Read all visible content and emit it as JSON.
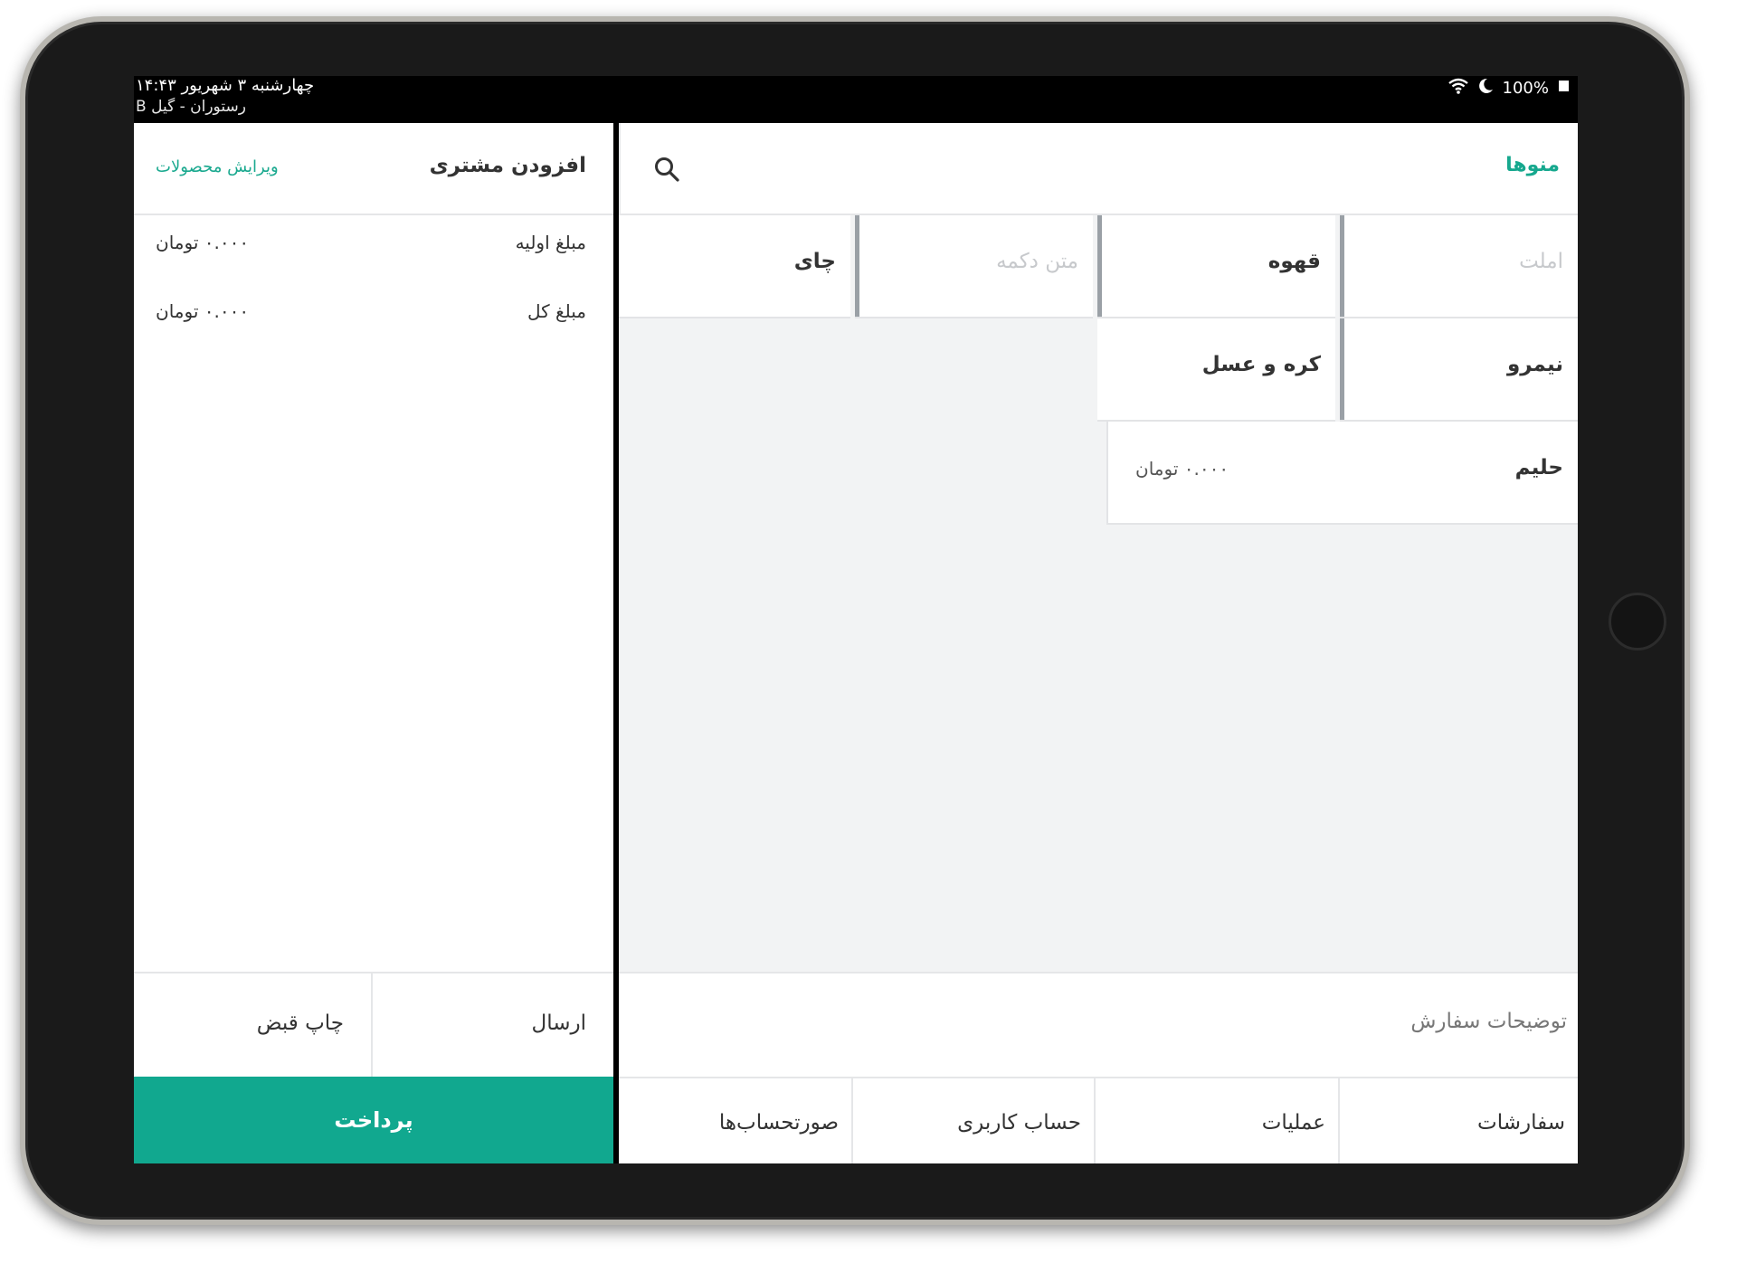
{
  "status_bar": {
    "datetime": "چهارشنبه ۳ شهریور  ۱۴:۴۳",
    "store_name": "رستوران - گیل B",
    "battery": "100%",
    "wifi_icon": "wifi-icon",
    "moon_icon": "moon-icon",
    "battery_icon": "battery-icon"
  },
  "cart": {
    "add_customer": "افزودن مشتری",
    "edit_products": "ویرایش محصولات",
    "summary": [
      {
        "label": "مبلغ اولیه",
        "value": "۰.۰۰۰ تومان"
      },
      {
        "label": "مبلغ کل",
        "value": "۰.۰۰۰ تومان"
      }
    ],
    "send": "ارسال",
    "print_receipt": "چاپ قبض",
    "pay": "پرداخت"
  },
  "menu": {
    "title": "منوها",
    "search_icon": "search-icon",
    "tiles": [
      {
        "name": "املت",
        "muted": true
      },
      {
        "name": "قهوه",
        "muted": false
      },
      {
        "name": "متن دکمه",
        "muted": true
      },
      {
        "name": "چای",
        "muted": false
      },
      {
        "name": "نیمرو",
        "muted": false
      },
      {
        "name": "کره و عسل",
        "muted": false
      },
      {
        "name": "حلیم",
        "price": "۰.۰۰۰ تومان"
      }
    ],
    "order_notes": "توضیحات سفارش",
    "tabs": [
      "سفارشات",
      "عملیات",
      "حساب کاربری",
      "صورتحساب‌ها"
    ]
  },
  "colors": {
    "accent": "#11a88f",
    "tile_bar": "#9aa0a6",
    "canvas": "#f2f3f4"
  }
}
